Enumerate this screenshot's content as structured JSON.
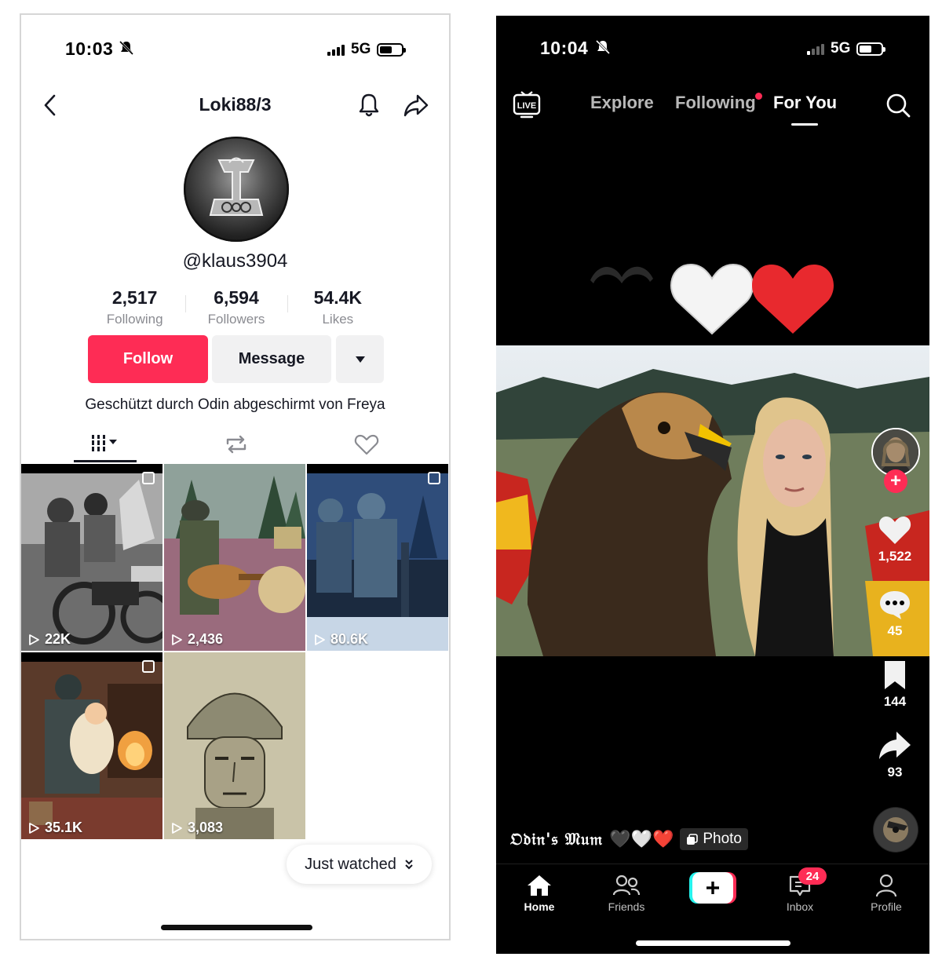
{
  "left_screen": {
    "status_bar": {
      "time": "10:03",
      "network": "5G"
    },
    "header": {
      "title": "Loki88/3"
    },
    "profile": {
      "handle": "@klaus3904",
      "stats": [
        {
          "value": "2,517",
          "label": "Following"
        },
        {
          "value": "6,594",
          "label": "Followers"
        },
        {
          "value": "54.4K",
          "label": "Likes"
        }
      ],
      "buttons": {
        "follow": "Follow",
        "message": "Message"
      },
      "bio": "Geschützt durch Odin abgeschirmt von Freya"
    },
    "videos": [
      {
        "views": "22K"
      },
      {
        "views": "2,436"
      },
      {
        "views": "80.6K"
      },
      {
        "views": "35.1K"
      },
      {
        "views": "3,083"
      }
    ],
    "just_watched": "Just watched"
  },
  "right_screen": {
    "status_bar": {
      "time": "10:04",
      "network": "5G"
    },
    "top_nav": {
      "live": "LIVE",
      "tabs": [
        "Explore",
        "Following",
        "For You"
      ],
      "active_tab": "For You"
    },
    "actions": {
      "likes": "1,522",
      "comments": "45",
      "saves": "144",
      "shares": "93"
    },
    "caption": {
      "author": "𝔒𝔡𝔦𝔫'𝔰 𝔐𝔲𝔪",
      "hearts": "🖤🤍❤️",
      "photo_label": "Photo"
    },
    "bottom_nav": {
      "items": [
        "Home",
        "Friends",
        "Inbox",
        "Profile"
      ],
      "inbox_badge": "24"
    }
  },
  "colors": {
    "accent": "#fe2c55",
    "text_dark": "#161823",
    "muted": "#8a8b91"
  }
}
